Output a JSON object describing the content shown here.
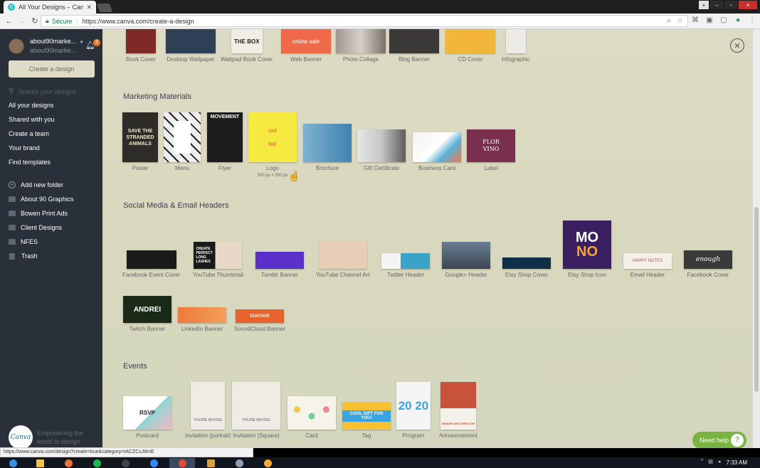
{
  "browser": {
    "tab_title": "All Your Designs – Canva",
    "tab_favicon": "C",
    "secure_label": "Secure",
    "url": "https://www.canva.com/create-a-design",
    "status_url": "https://www.canva.com/design?create=true&category=tACZCsJ8mE"
  },
  "sidebar": {
    "username": "about90marke...",
    "email": "about90marke...",
    "notif_count": "2",
    "create_button": "Create a design",
    "search_placeholder": "Search your designs",
    "nav": [
      "All your designs",
      "Shared with you",
      "Create a team",
      "Your brand",
      "Find templates"
    ],
    "add_folder": "Add new folder",
    "folders": [
      "About 90 Graphics",
      "Bowen Print Ads",
      "Client Designs",
      "NFES"
    ],
    "trash": "Trash",
    "logo_text": "Canva",
    "tagline_1": "Empowering the",
    "tagline_2": "world to design"
  },
  "top_row": {
    "items": [
      "Book Cover",
      "Desktop Wallpaper",
      "Wattpad Book Cover",
      "Web Banner",
      "Photo Collage",
      "Blog Banner",
      "CD Cover",
      "Infographic"
    ],
    "thumb_text": {
      "wattpad": "THE BOX",
      "web_banner": "online sale"
    }
  },
  "marketing": {
    "title": "Marketing Materials",
    "items": [
      "Poster",
      "Menu",
      "Flyer",
      "Logo",
      "Brochure",
      "Gift Certificate",
      "Business Card",
      "Label"
    ],
    "logo_sub": "500 px × 500 px",
    "thumb_text": {
      "poster": "SAVE THE STRANDED ANIMALS",
      "flyer": "MOVEMENT",
      "logo_1": "rad",
      "logo_2": "kid",
      "label_1": "FLOR",
      "label_2": "VINO"
    }
  },
  "social": {
    "title": "Social Media & Email Headers",
    "items": [
      "Facebook Event Cover",
      "YouTube Thumbnail",
      "Tumblr Banner",
      "YouTube Channel Art",
      "Twitter Header",
      "Google+ Header",
      "Etsy Shop Cover",
      "Etsy Shop Icon",
      "Email Header",
      "Facebook Cover",
      "Twitch Banner",
      "LinkedIn Banner",
      "SoundCloud Banner"
    ],
    "thumb_text": {
      "yt_thumb": "CREATE PERFECT LONG LASHES",
      "etsy_icon_1": "MO",
      "etsy_icon_2": "NO",
      "email": "HAPPY NOTES",
      "fb_cover": "enough",
      "twitch": "ANDREI",
      "soundcloud": "GUSTAVE"
    }
  },
  "events": {
    "title": "Events",
    "items": [
      "Postcard",
      "Invitation (portrait)",
      "Invitation (Square)",
      "Card",
      "Tag",
      "Program",
      "Announcement"
    ],
    "thumb_text": {
      "postcard": "RSVP",
      "invite": "YOU'RE INVITED",
      "tag": "COOL GIFT FOR YOU!",
      "program": "20 20",
      "announcement": "SENIOR ART DIRECTOR"
    }
  },
  "help": {
    "label": "Need help",
    "q": "?"
  },
  "taskbar": {
    "time": "7:33 AM"
  }
}
